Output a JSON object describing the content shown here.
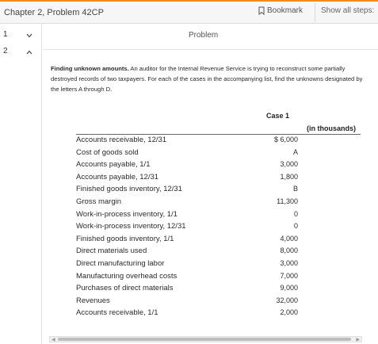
{
  "header": {
    "title": "Chapter 2, Problem 42CP",
    "bookmark_label": "Bookmark",
    "show_steps_label": "Show all steps:"
  },
  "steps": [
    {
      "number": "1",
      "chevron": "chevron-down-icon"
    },
    {
      "number": "2",
      "chevron": "chevron-up-icon"
    }
  ],
  "problem": {
    "label": "Problem",
    "bold_lead": "Finding unknown amounts.",
    "text": " An auditor for the Internal Revenue Service is trying to reconstruct some partially destroyed records of two taxpayers. For each of the cases in the accompanying list, find the unknowns designated by the letters A through D."
  },
  "table": {
    "case_header": "Case 1",
    "unit_note": "(in thousands)",
    "rows": [
      {
        "label": "Accounts receivable, 12/31",
        "value": "$ 6,000"
      },
      {
        "label": "Cost of goods sold",
        "value": "A"
      },
      {
        "label": "Accounts payable, 1/1",
        "value": "3,000"
      },
      {
        "label": "Accounts payable, 12/31",
        "value": "1,800"
      },
      {
        "label": "Finished goods inventory, 12/31",
        "value": "B"
      },
      {
        "label": "Gross margin",
        "value": "11,300"
      },
      {
        "label": "Work-in-process inventory, 1/1",
        "value": "0"
      },
      {
        "label": "Work-in-process inventory, 12/31",
        "value": "0"
      },
      {
        "label": "Finished goods inventory, 1/1",
        "value": "4,000"
      },
      {
        "label": "Direct materials used",
        "value": "8,000"
      },
      {
        "label": "Direct manufacturing labor",
        "value": "3,000"
      },
      {
        "label": "Manufacturing overhead costs",
        "value": "7,000"
      },
      {
        "label": "Purchases of direct materials",
        "value": "9,000"
      },
      {
        "label": "Revenues",
        "value": "32,000"
      },
      {
        "label": "Accounts receivable, 1/1",
        "value": "2,000"
      }
    ]
  },
  "colors": {
    "accent": "#f08a1c",
    "header_bg": "#f6f6f6"
  }
}
